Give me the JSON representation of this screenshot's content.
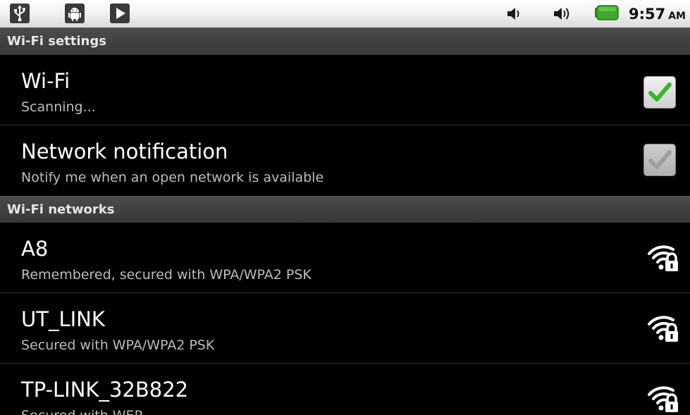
{
  "status_bar": {
    "icons": [
      "usb-icon",
      "android-debug-icon",
      "play-store-icon",
      "volume-icon",
      "volume-icon",
      "battery-icon"
    ],
    "time": "9:57",
    "ampm": "AM",
    "battery_color": "#3ea82c"
  },
  "wifi_settings": {
    "header": "Wi-Fi settings",
    "wifi": {
      "title": "Wi-Fi",
      "summary": "Scanning...",
      "checked": true
    },
    "notification": {
      "title": "Network notification",
      "summary": "Notify me when an open network is available",
      "checked": true,
      "enabled": false
    }
  },
  "wifi_networks": {
    "header": "Wi-Fi networks",
    "networks": [
      {
        "ssid": "A8",
        "summary": "Remembered, secured with WPA/WPA2 PSK",
        "icon": "wifi-lock-icon"
      },
      {
        "ssid": "UT_LINK",
        "summary": "Secured with WPA/WPA2 PSK",
        "icon": "wifi-lock-icon"
      },
      {
        "ssid": "TP-LINK_32B822",
        "summary": "Secured with WEP",
        "icon": "wifi-lock-icon"
      }
    ]
  },
  "colors": {
    "check_green": "#37b72a",
    "check_disabled": "#bdbdbd",
    "summary_text": "#bdbdbd"
  }
}
